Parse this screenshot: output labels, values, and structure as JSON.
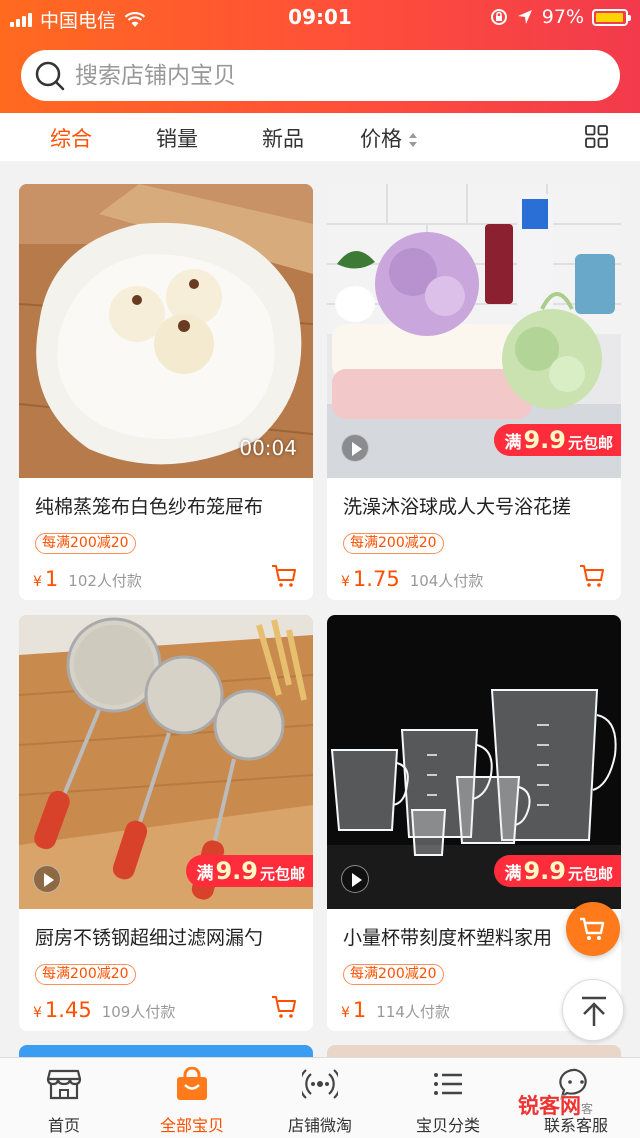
{
  "status_bar": {
    "carrier": "中国电信",
    "time": "09:01",
    "battery": "97%"
  },
  "search": {
    "placeholder": "搜索店铺内宝贝"
  },
  "sort_tabs": [
    "综合",
    "销量",
    "新品",
    "价格"
  ],
  "products": [
    {
      "title": "纯棉蒸笼布白色纱布笼屉布",
      "coupon": "每满200减20",
      "currency": "¥",
      "price": "1",
      "sales": "102人付款",
      "video_duration": "00:04"
    },
    {
      "title": "洗澡沐浴球成人大号浴花搓",
      "coupon": "每满200减20",
      "currency": "¥",
      "price": "1.75",
      "sales": "104人付款",
      "promo": {
        "prefix": "满",
        "amount": "9.9",
        "suffix": "元包邮"
      }
    },
    {
      "title": "厨房不锈钢超细过滤网漏勺",
      "coupon": "每满200减20",
      "currency": "¥",
      "price": "1.45",
      "sales": "109人付款",
      "promo": {
        "prefix": "满",
        "amount": "9.9",
        "suffix": "元包邮"
      }
    },
    {
      "title": "小量杯带刻度杯塑料家用",
      "coupon": "每满200减20",
      "currency": "¥",
      "price": "1",
      "sales": "114人付款",
      "promo": {
        "prefix": "满",
        "amount": "9.9",
        "suffix": "元包邮"
      }
    }
  ],
  "tab_bar": [
    {
      "label": "首页",
      "icon": "storefront-icon"
    },
    {
      "label": "全部宝贝",
      "icon": "shopping-bag-icon"
    },
    {
      "label": "店铺微淘",
      "icon": "broadcast-icon"
    },
    {
      "label": "宝贝分类",
      "icon": "list-icon"
    },
    {
      "label": "联系客服",
      "icon": "chat-icon"
    }
  ],
  "watermark": {
    "main": "锐客网",
    "small": "客"
  },
  "colors": {
    "accent": "#ff5000",
    "header_start": "#ff6a1f",
    "header_end": "#f23a4c",
    "promo": "#ff2d3c"
  }
}
